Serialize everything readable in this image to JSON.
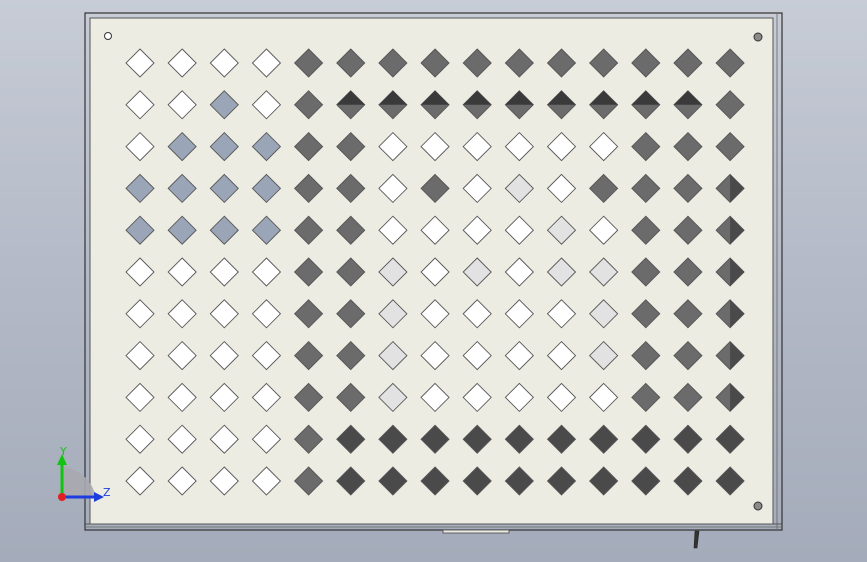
{
  "app": {
    "view": "cad-3d-viewport",
    "background_top": "#c7ccd6",
    "background_bottom": "#a4abba"
  },
  "part": {
    "name": "perforated-panel",
    "face_color": "#ecece3",
    "edge_color": "#3c3c3c",
    "hole_shape": "diamond",
    "hole_grid_rows": 11,
    "hole_grid_cols": 15,
    "mounting_holes": 3,
    "hole_colors": {
      "white": "#ffffff",
      "light": "#e2e2e2",
      "blue": "#9aa6b8",
      "gray": "#6b6b6b",
      "dark": "#4a4a4a",
      "outline": "#555555"
    }
  },
  "triad": {
    "y_label": "Y",
    "z_label": "Z",
    "y_color": "#13c313",
    "z_color": "#1d3ce0",
    "origin_color": "#e02020"
  }
}
